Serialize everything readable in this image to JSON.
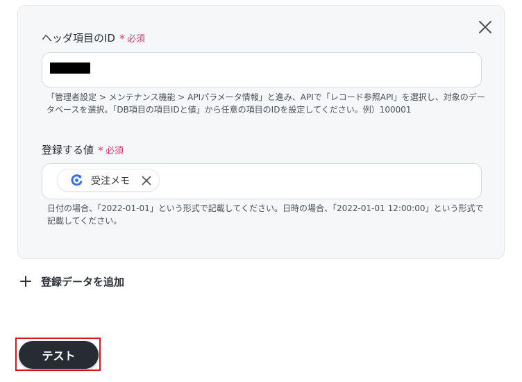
{
  "form": {
    "field1": {
      "label": "ヘッダ項目のID",
      "required_label": "必須",
      "value": "",
      "help_line1": "「管理者設定 > メンテナンス機能 > APIパラメータ情報」と進み、APIで「レコード参照API」を選択し、対象のデー",
      "help_line2": "タベースを選択。「DB項目の項目IDと値」から任意の項目のIDを設定してください。例）100001"
    },
    "field2": {
      "label": "登録する値",
      "required_label": "必須",
      "chip_label": "受注メモ",
      "help_line1": "日付の場合、「2022-01-01」という形式で記載してください。日時の場合、「2022-01-01 12:00:00」という形式で",
      "help_line2": "記載してください。"
    }
  },
  "actions": {
    "add_label": "登録データを追加",
    "test_label": "テスト"
  },
  "colors": {
    "required": "#e0336d",
    "chip_icon": "#3d6ee8",
    "button_bg": "#272c33",
    "highlight_border": "#e0141e"
  },
  "icons": {
    "close": "close-icon",
    "chip_service": "service-logo-icon",
    "chip_remove": "remove-icon",
    "add": "plus-icon"
  }
}
